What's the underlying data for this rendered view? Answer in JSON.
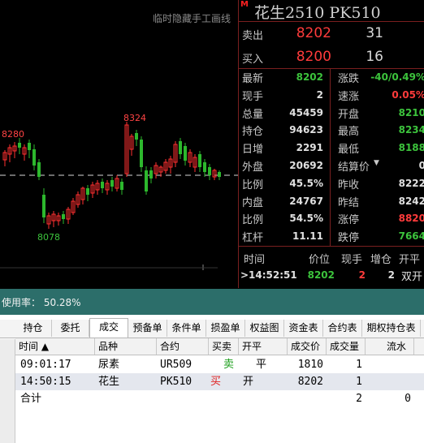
{
  "chart": {
    "hint": "临时隐藏手工画线",
    "high_label": "8324",
    "left_label": "8280",
    "low_label": "8078"
  },
  "quote": {
    "m_badge": "M",
    "instrument_title": "花生2510 PK510",
    "sell_label": "卖出",
    "sell_price": "8202",
    "sell_volume": "31",
    "buy_label": "买入",
    "buy_price": "8200",
    "buy_volume": "16",
    "left_rows": [
      {
        "label": "最新",
        "value": "8202",
        "color": "#3cc33c"
      },
      {
        "label": "现手",
        "value": "2",
        "color": "#e0e0e0"
      },
      {
        "label": "总量",
        "value": "45459",
        "color": "#e0e0e0"
      },
      {
        "label": "持仓",
        "value": "94623",
        "color": "#e0e0e0"
      },
      {
        "label": "日增",
        "value": "2291",
        "color": "#e0e0e0"
      },
      {
        "label": "外盘",
        "value": "20692",
        "color": "#e0e0e0"
      },
      {
        "label": "比例",
        "value": "45.5%",
        "color": "#e0e0e0"
      },
      {
        "label": "内盘",
        "value": "24767",
        "color": "#e0e0e0"
      },
      {
        "label": "比例",
        "value": "54.5%",
        "color": "#e0e0e0"
      },
      {
        "label": "杠杆",
        "value": "11.11",
        "color": "#e0e0e0"
      }
    ],
    "right_rows": [
      {
        "label": "涨跌",
        "value": "-40/0.49%",
        "color": "#3cc33c"
      },
      {
        "label": "速涨",
        "value": "0.05%",
        "color": "#ff3b3b"
      },
      {
        "label": "开盘",
        "value": "8210",
        "color": "#3cc33c"
      },
      {
        "label": "最高",
        "value": "8234",
        "color": "#3cc33c"
      },
      {
        "label": "最低",
        "value": "8188",
        "color": "#3cc33c"
      },
      {
        "label": "结算价",
        "value": "0",
        "color": "#e0e0e0"
      },
      {
        "label": "昨收",
        "value": "8222",
        "color": "#e0e0e0"
      },
      {
        "label": "昨结",
        "value": "8242",
        "color": "#e0e0e0"
      },
      {
        "label": "涨停",
        "value": "8820",
        "color": "#ff3b3b"
      },
      {
        "label": "跌停",
        "value": "7664",
        "color": "#3cc33c"
      }
    ],
    "tick_header": {
      "time": "时间",
      "price": "价位",
      "hand": "现手",
      "incr": "增仓",
      "open_close": "开平"
    },
    "tick_row": {
      "time": ">14:52:51",
      "price": "8202",
      "hand": "2",
      "incr": "2",
      "open_close": "双开"
    }
  },
  "status": {
    "usage_text": "使用率： 50.28%"
  },
  "tabs": [
    "持仓",
    "委托",
    "成交",
    "预备单",
    "条件单",
    "损盈单",
    "权益图",
    "资金表",
    "合约表",
    "期权持仓表"
  ],
  "active_tab": "成交",
  "grid": {
    "headers": [
      "时间 ▲",
      "品种",
      "合约",
      "买卖",
      "开平",
      "成交价",
      "成交量",
      "流水"
    ],
    "rows": [
      {
        "time": "09:01:17",
        "product": "尿素",
        "contract": "UR509",
        "side": "卖",
        "side_color": "#1a9e1a",
        "oc": "平",
        "price": "1810",
        "qty": "1",
        "flow": ""
      },
      {
        "time": "14:50:15",
        "product": "花生",
        "contract": "PK510",
        "side": "买",
        "side_color": "#e02020",
        "oc": "开",
        "price": "8202",
        "qty": "1",
        "flow": ""
      }
    ],
    "total": {
      "label": "合计",
      "qty": "2",
      "flow": "0"
    }
  }
}
